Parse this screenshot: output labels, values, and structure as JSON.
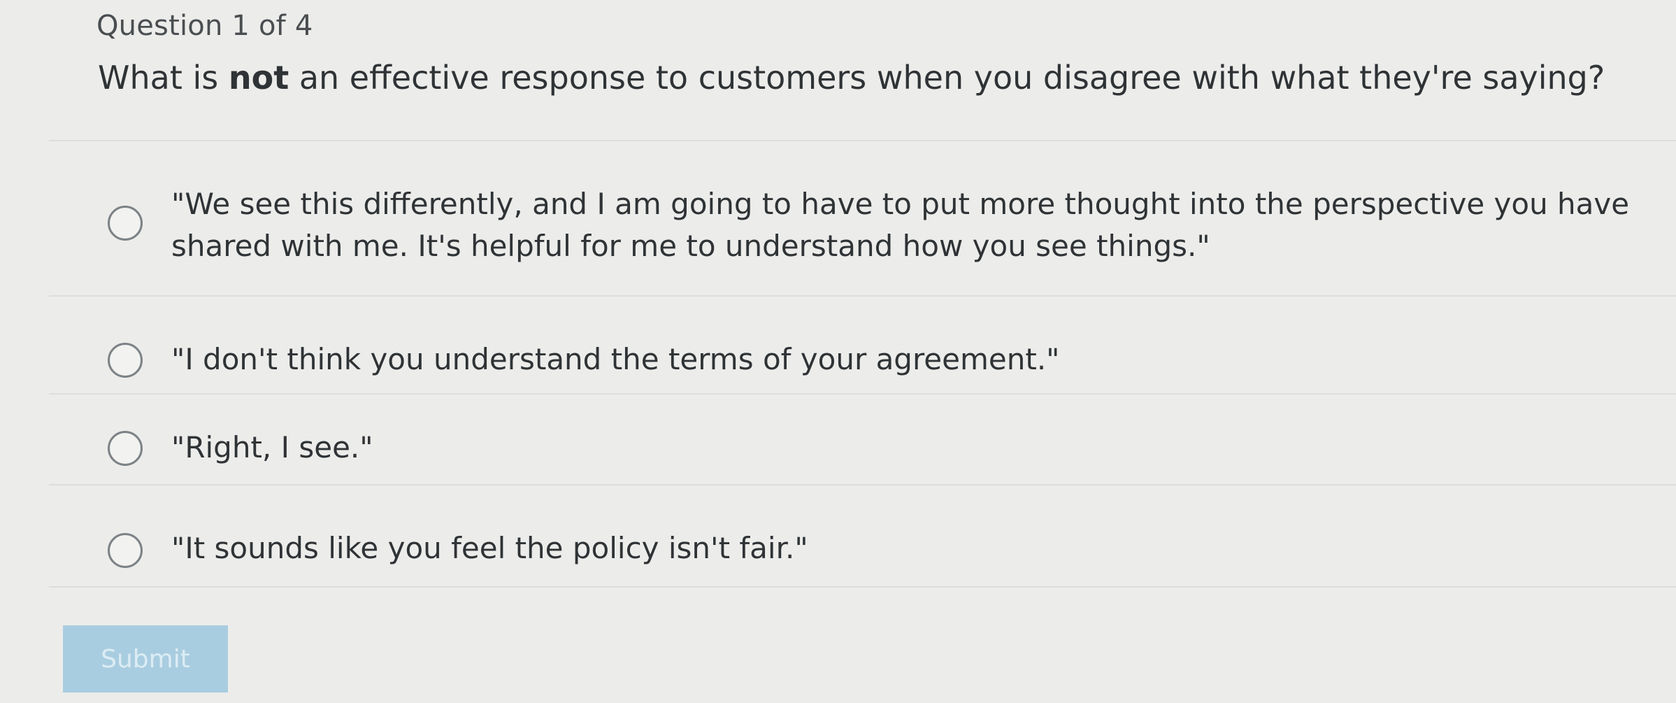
{
  "quiz": {
    "counter": "Question 1 of 4",
    "question": {
      "prefix": "What is ",
      "emphasis": "not",
      "suffix": " an effective response to customers when you disagree with what they're saying?"
    },
    "options": [
      {
        "label": "\"We see this differently, and I am going to have to put more thought into the perspective you have shared with me. It's helpful for me to understand how you see things.\"",
        "selected": false
      },
      {
        "label": "\"I don't think you understand the terms of your agreement.\"",
        "selected": false
      },
      {
        "label": "\"Right, I see.\"",
        "selected": false
      },
      {
        "label": "\"It sounds like you feel the policy isn't fair.\"",
        "selected": false
      }
    ],
    "submit_label": "Submit",
    "submit_enabled": false
  }
}
